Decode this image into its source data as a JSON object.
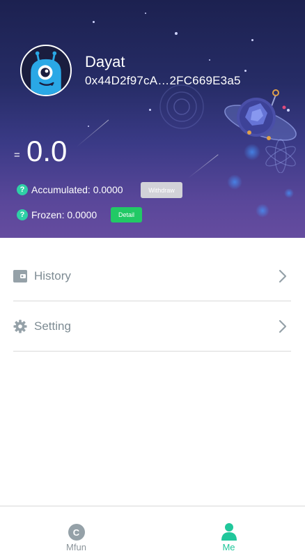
{
  "profile": {
    "name": "Dayat",
    "address": "0x44D2f97cA…2FC669E3a5"
  },
  "balance": {
    "prefix": "=",
    "value": "0.0"
  },
  "stats": {
    "accumulated_label": "Accumulated: 0.0000",
    "frozen_label": "Frozen: 0.0000",
    "help_glyph": "?",
    "withdraw_button": "Withdraw",
    "detail_button": "Detail"
  },
  "menu": {
    "items": [
      {
        "label": "History",
        "icon": "wallet-icon"
      },
      {
        "label": "Setting",
        "icon": "gear-icon"
      }
    ]
  },
  "tabbar": {
    "tabs": [
      {
        "label": "Mfun",
        "icon": "mfun-logo-icon",
        "glyph": "C",
        "active": false
      },
      {
        "label": "Me",
        "icon": "person-icon",
        "active": true
      }
    ]
  },
  "colors": {
    "accent_green": "#20c79b",
    "detail_green": "#21c965",
    "header_top": "#1c2150",
    "header_bottom": "#654c9f",
    "menu_text": "#7d8b93"
  }
}
